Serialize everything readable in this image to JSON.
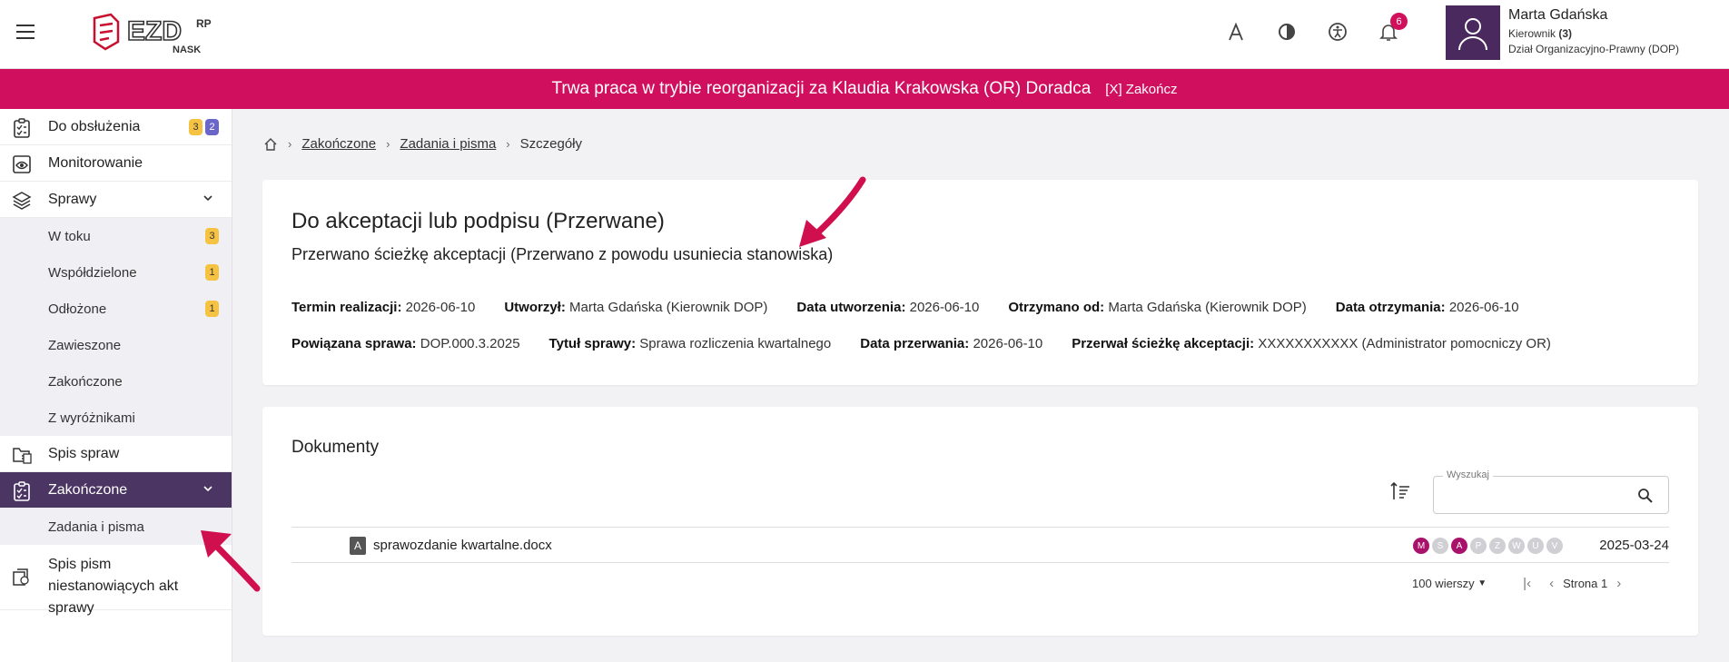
{
  "header": {
    "logo_text": "EZD",
    "logo_sup": "RP",
    "logo_sub": "NASK",
    "notification_count": "6",
    "icons": [
      "font-size-icon",
      "contrast-icon",
      "accessibility-icon",
      "bell-icon"
    ],
    "user": {
      "name": "Marta Gdańska",
      "role": "Kierownik",
      "role_count": "(3)",
      "department": "Dział Organizacyjno-Prawny (DOP)"
    }
  },
  "banner": {
    "text": "Trwa praca w trybie reorganizacji za Klaudia Krakowska (OR) Doradca",
    "link": "[X] Zakończ"
  },
  "sidebar": {
    "items": [
      {
        "label": "Do obsłużenia",
        "badges": [
          "3",
          "2"
        ]
      },
      {
        "label": "Monitorowanie"
      },
      {
        "label": "Sprawy"
      },
      {
        "label": "W toku",
        "badge": "3"
      },
      {
        "label": "Współdzielone",
        "badge": "1"
      },
      {
        "label": "Odłożone",
        "badge": "1"
      },
      {
        "label": "Zawieszone"
      },
      {
        "label": "Zakończone"
      },
      {
        "label": "Z wyróżnikami"
      },
      {
        "label": "Spis spraw"
      },
      {
        "label": "Zakończone"
      },
      {
        "label": "Zadania i pisma"
      },
      {
        "label": "Spis pism niestanowiących akt sprawy"
      }
    ]
  },
  "breadcrumb": {
    "items": [
      "Zakończone",
      "Zadania i pisma",
      "Szczegóły"
    ]
  },
  "details": {
    "title": "Do akceptacji lub podpisu (Przerwane)",
    "subtitle": "Przerwano ścieżkę akceptacji (Przerwano z powodu usuniecia stanowiska)",
    "fields_row1": [
      {
        "label": "Termin realizacji:",
        "value": "2026-06-10"
      },
      {
        "label": "Utworzył:",
        "value": "Marta Gdańska (Kierownik DOP)"
      },
      {
        "label": "Data utworzenia:",
        "value": "2026-06-10"
      },
      {
        "label": "Otrzymano od:",
        "value": "Marta Gdańska (Kierownik DOP)"
      },
      {
        "label": "Data otrzymania:",
        "value": "2026-06-10"
      }
    ],
    "fields_row2": [
      {
        "label": "Powiązana sprawa:",
        "value": "DOP.000.3.2025"
      },
      {
        "label": "Tytuł sprawy:",
        "value": "Sprawa rozliczenia kwartalnego"
      },
      {
        "label": "Data przerwania:",
        "value": "2026-06-10"
      },
      {
        "label": "Przerwał ścieżkę akceptacji:",
        "value": "XXXXXXXXXXX (Administrator pomocniczy OR)"
      }
    ]
  },
  "documents": {
    "title": "Dokumenty",
    "search_label": "Wyszukaj",
    "rows": [
      {
        "type": "A",
        "name": "sprawozdanie kwartalne.docx",
        "statuses": [
          "M",
          "S",
          "A",
          "P",
          "Z",
          "W",
          "U",
          "V"
        ],
        "active": [
          "M",
          "A"
        ],
        "date": "2025-03-24"
      }
    ],
    "pager": {
      "rows_per_page": "100 wierszy",
      "page_label": "Strona 1"
    }
  },
  "colors": {
    "accent": "#d0105e",
    "sidebar_active": "#4b3563",
    "badge_yellow": "#f5c242",
    "badge_blue": "#6b66c9",
    "status_on": "#a8126a"
  }
}
